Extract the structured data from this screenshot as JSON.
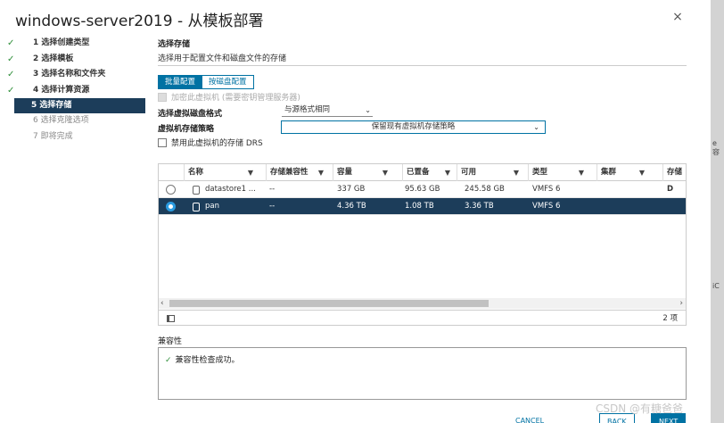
{
  "dialog": {
    "title": "windows-server2019 - 从模板部署",
    "close": "×"
  },
  "steps": [
    {
      "label": "1 选择创建类型",
      "state": "done"
    },
    {
      "label": "2 选择模板",
      "state": "done"
    },
    {
      "label": "3 选择名称和文件夹",
      "state": "done"
    },
    {
      "label": "4 选择计算资源",
      "state": "done"
    },
    {
      "label": "5 选择存储",
      "state": "active"
    },
    {
      "label": "6 选择克隆选项",
      "state": "pending"
    },
    {
      "label": "7 即将完成",
      "state": "pending"
    }
  ],
  "main": {
    "title": "选择存储",
    "description": "选择用于配置文件和磁盘文件的存储",
    "toggle": {
      "batch": "批量配置",
      "per_disk": "按磁盘配置"
    },
    "encrypt_label": "加密此虚拟机 (需要密钥管理服务器)",
    "disk_format_label": "选择虚拟磁盘格式",
    "disk_format_value": "与源格式相同",
    "policy_label": "虚拟机存储策略",
    "policy_value": "保留现有虚拟机存储策略",
    "drs_label": "禁用此虚拟机的存储 DRS"
  },
  "table": {
    "headers": [
      "名称",
      "存储兼容性",
      "容量",
      "已置备",
      "可用",
      "类型",
      "集群",
      "存储 D"
    ],
    "rows": [
      {
        "name": "datastore1 ...",
        "compat": "--",
        "capacity": "337 GB",
        "provisioned": "95.63 GB",
        "free": "245.58 GB",
        "type": "VMFS 6",
        "selected": false
      },
      {
        "name": "pan",
        "compat": "--",
        "capacity": "4.36 TB",
        "provisioned": "1.08 TB",
        "free": "3.36 TB",
        "type": "VMFS 6",
        "selected": true
      }
    ],
    "count": "2 项"
  },
  "compat": {
    "label": "兼容性",
    "message": "兼容性检查成功。"
  },
  "footer": {
    "cancel": "CANCEL",
    "back": "BACK",
    "next": "NEXT"
  },
  "watermark": "CSDN @有糖爸爸",
  "background_fragments": [
    "e 容",
    "iC"
  ]
}
